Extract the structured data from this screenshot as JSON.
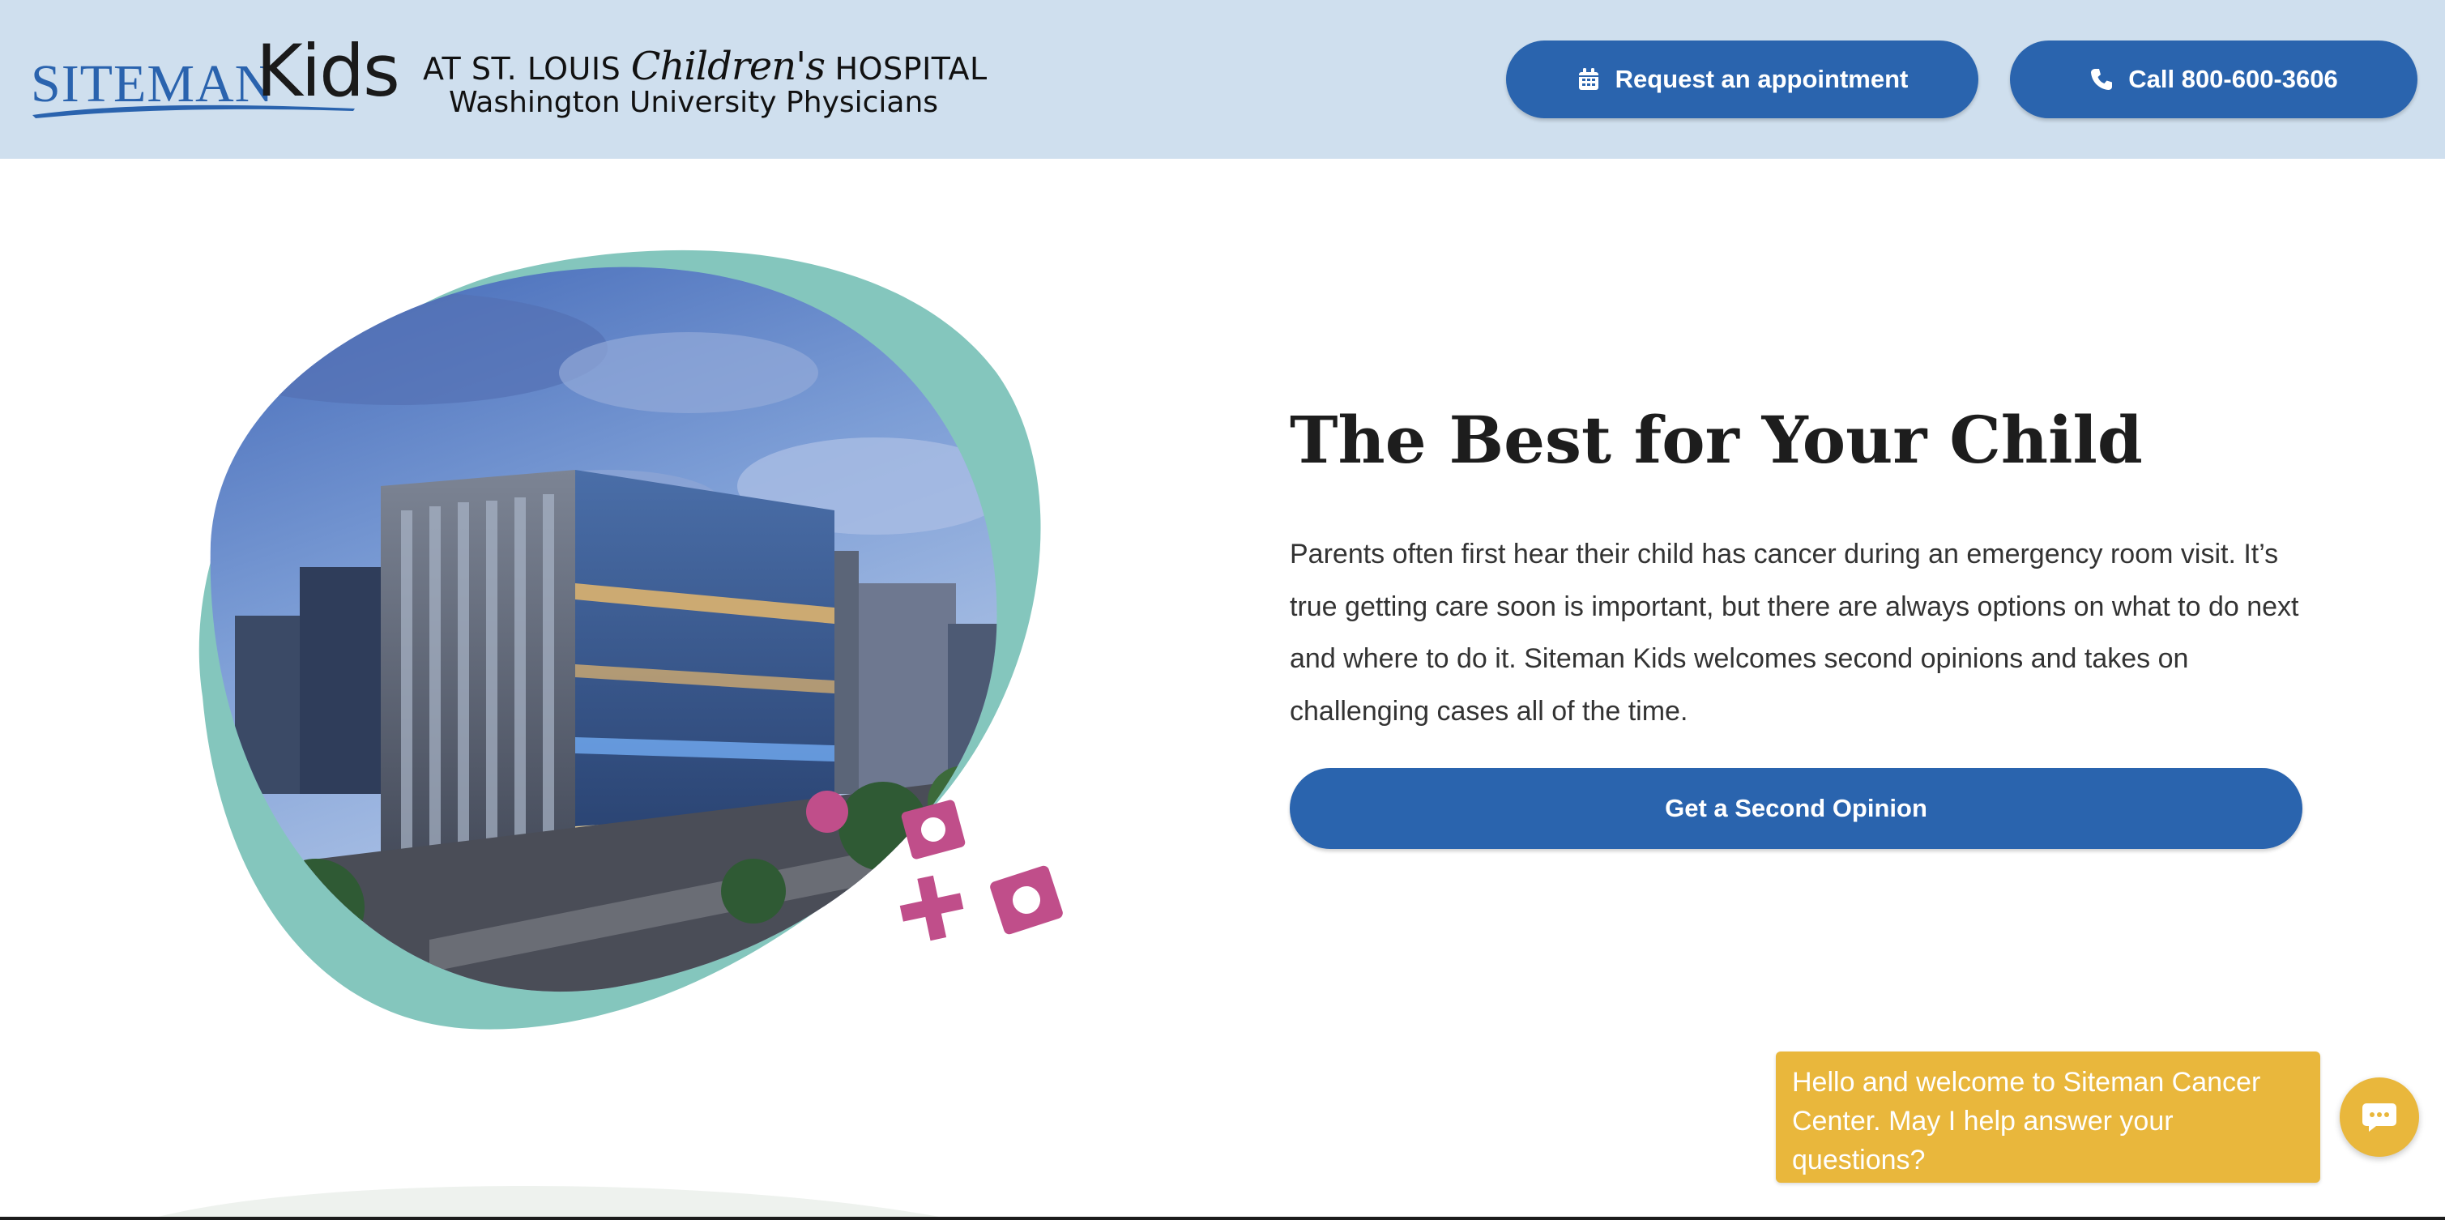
{
  "header": {
    "logo": {
      "brand": "SITEMAN",
      "brand_kids": "Kids",
      "partner_line1_prefix": "AT ST. LOUIS",
      "partner_line1_children": "Children's",
      "partner_line1_suffix": "HOSPITAL",
      "partner_line2": "Washington University Physicians"
    },
    "appointment_button": {
      "label": "Request an appointment",
      "icon": "calendar-icon"
    },
    "call_button": {
      "label": "Call 800-600-3606",
      "icon": "phone-icon"
    }
  },
  "hero": {
    "image_alt": "Hospital building at dusk",
    "title": "The Best for Your Child",
    "body": "Parents often first hear their child has cancer during an emergency room visit. It’s true getting care soon is important, but there are always options on what to do next and where to do it. Siteman Kids welcomes second opinions and takes on challenging cases all of the time.",
    "cta_label": "Get a Second Opinion"
  },
  "chat": {
    "message": "Hello and welcome to Siteman Cancer Center. May I help answer your questions?",
    "launcher_icon": "chat-icon"
  },
  "colors": {
    "header_bg": "#cfdfee",
    "primary_blue": "#2a64ae",
    "teal_blob": "#84c6bd",
    "accent_magenta": "#c04e8a",
    "chat_yellow": "#e9b73c"
  }
}
